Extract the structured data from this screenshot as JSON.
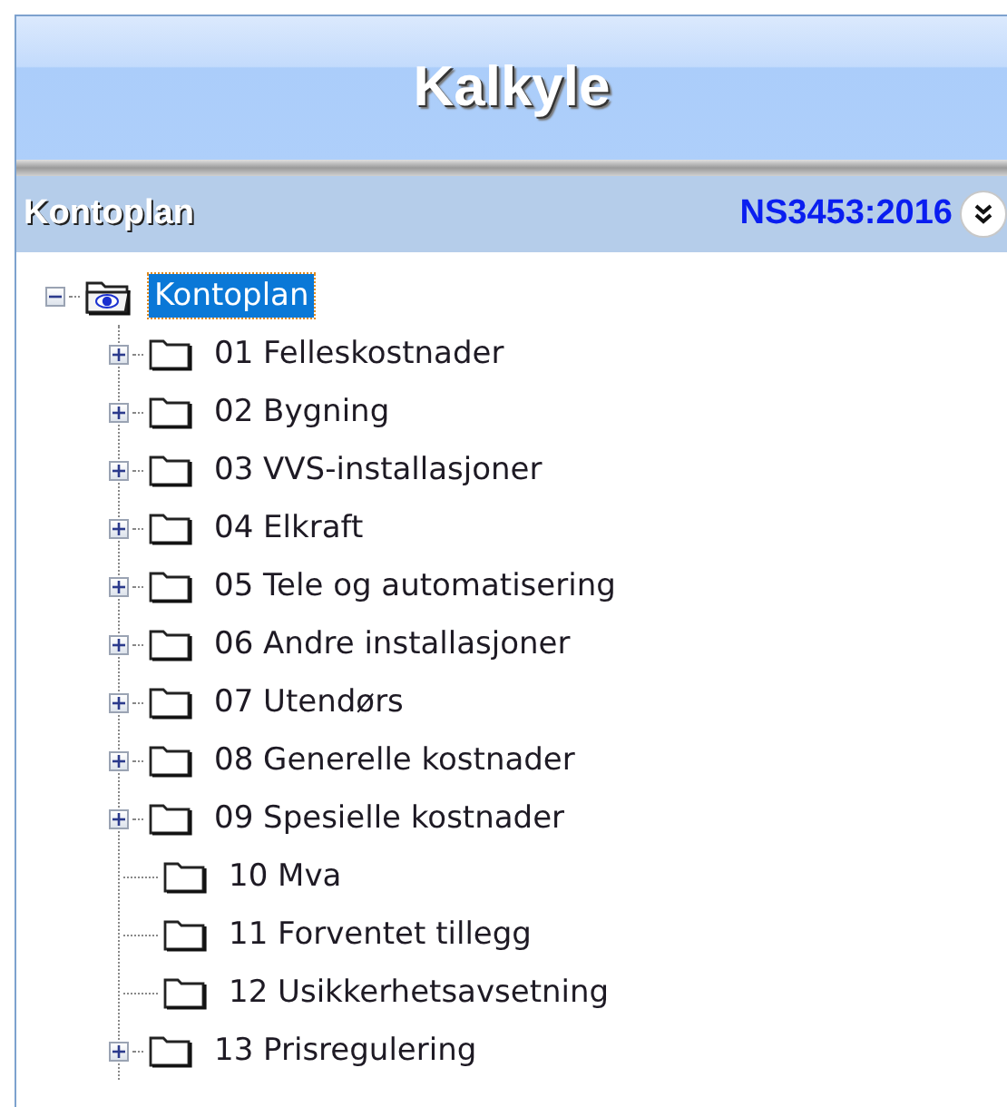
{
  "header": {
    "title": "Kalkyle"
  },
  "section": {
    "title": "Kontoplan",
    "standard": "NS3453:2016"
  },
  "tree": {
    "label": "Kontoplan",
    "selected": true,
    "expanded": true,
    "children": [
      {
        "label": "01 Felleskostnader",
        "selected": false,
        "expandable": true
      },
      {
        "label": "02 Bygning",
        "selected": false,
        "expandable": true
      },
      {
        "label": "03 VVS-installasjoner",
        "selected": false,
        "expandable": true
      },
      {
        "label": "04 Elkraft",
        "selected": false,
        "expandable": true
      },
      {
        "label": "05 Tele og automatisering",
        "selected": false,
        "expandable": true
      },
      {
        "label": "06 Andre installasjoner",
        "selected": false,
        "expandable": true
      },
      {
        "label": "07 Utendørs",
        "selected": false,
        "expandable": true
      },
      {
        "label": "08 Generelle kostnader",
        "selected": false,
        "expandable": true
      },
      {
        "label": "09 Spesielle kostnader",
        "selected": false,
        "expandable": true
      },
      {
        "label": "10 Mva",
        "selected": false,
        "expandable": false
      },
      {
        "label": "11 Forventet tillegg",
        "selected": false,
        "expandable": false
      },
      {
        "label": "12 Usikkerhetsavsetning",
        "selected": false,
        "expandable": false
      },
      {
        "label": "13 Prisregulering",
        "selected": false,
        "expandable": true
      }
    ]
  }
}
